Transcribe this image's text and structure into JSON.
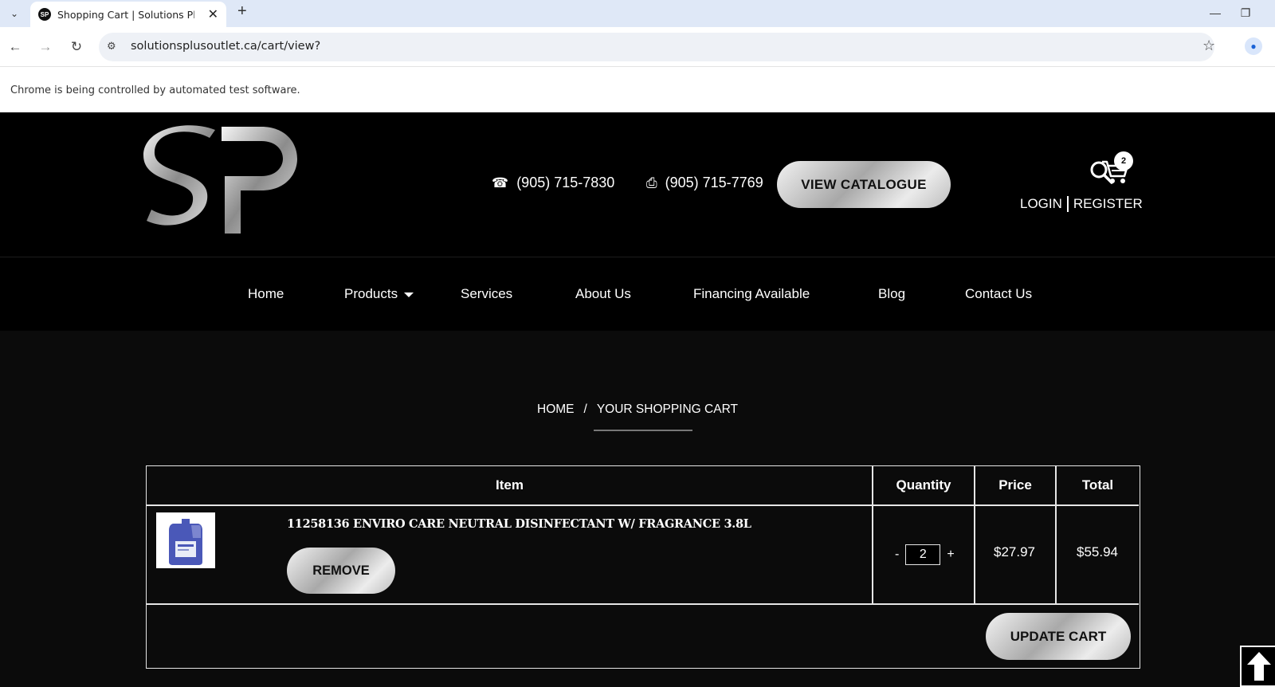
{
  "browser": {
    "tab_title": "Shopping Cart | Solutions Plus O",
    "url": "solutionsplusoutlet.ca/cart/view?",
    "infobar": "Chrome is being controlled by automated test software."
  },
  "header": {
    "phone": "(905) 715-7830",
    "fax": "(905) 715-7769",
    "catalogue_label": "VIEW CATALOGUE",
    "cart_count": "2",
    "login_label": "LOGIN",
    "register_label": "REGISTER"
  },
  "nav": {
    "items": [
      {
        "label": "Home"
      },
      {
        "label": "Products"
      },
      {
        "label": "Services"
      },
      {
        "label": "About Us"
      },
      {
        "label": "Financing Available"
      },
      {
        "label": "Blog"
      },
      {
        "label": "Contact Us"
      }
    ]
  },
  "breadcrumb": {
    "home": "HOME",
    "separator": "/",
    "current": "YOUR SHOPPING CART"
  },
  "cart": {
    "columns": [
      "Item",
      "Quantity",
      "Price",
      "Total"
    ],
    "rows": [
      {
        "name": "11258136 ENVIRO CARE NEUTRAL DISINFECTANT W/ FRAGRANCE 3.8L",
        "remove_label": "REMOVE",
        "qty_minus": "-",
        "quantity": "2",
        "qty_plus": "+",
        "price": "$27.97",
        "total": "$55.94"
      }
    ],
    "update_label": "UPDATE CART"
  },
  "colors": {
    "page_bg": "#0b0b0b",
    "header_bg": "#000000",
    "button_silver": "#c8c8c8"
  }
}
